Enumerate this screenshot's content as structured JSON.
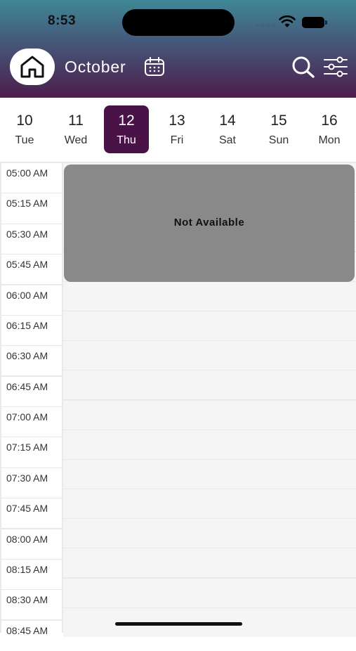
{
  "status_bar": {
    "time": "8:53"
  },
  "header": {
    "month": "October"
  },
  "days": [
    {
      "num": "10",
      "dow": "Tue"
    },
    {
      "num": "11",
      "dow": "Wed"
    },
    {
      "num": "12",
      "dow": "Thu"
    },
    {
      "num": "13",
      "dow": "Fri"
    },
    {
      "num": "14",
      "dow": "Sat"
    },
    {
      "num": "15",
      "dow": "Sun"
    },
    {
      "num": "16",
      "dow": "Mon"
    }
  ],
  "selected_day": "12",
  "times": [
    "05:00 AM",
    "05:15 AM",
    "05:30 AM",
    "05:45 AM",
    "06:00 AM",
    "06:15 AM",
    "06:30 AM",
    "06:45 AM",
    "07:00 AM",
    "07:15 AM",
    "07:30 AM",
    "07:45 AM",
    "08:00 AM",
    "08:15 AM",
    "08:30 AM",
    "08:45 AM"
  ],
  "block": {
    "label": "Not Available"
  },
  "colors": {
    "accent": "#4a1347",
    "unavailable": "#898989"
  }
}
